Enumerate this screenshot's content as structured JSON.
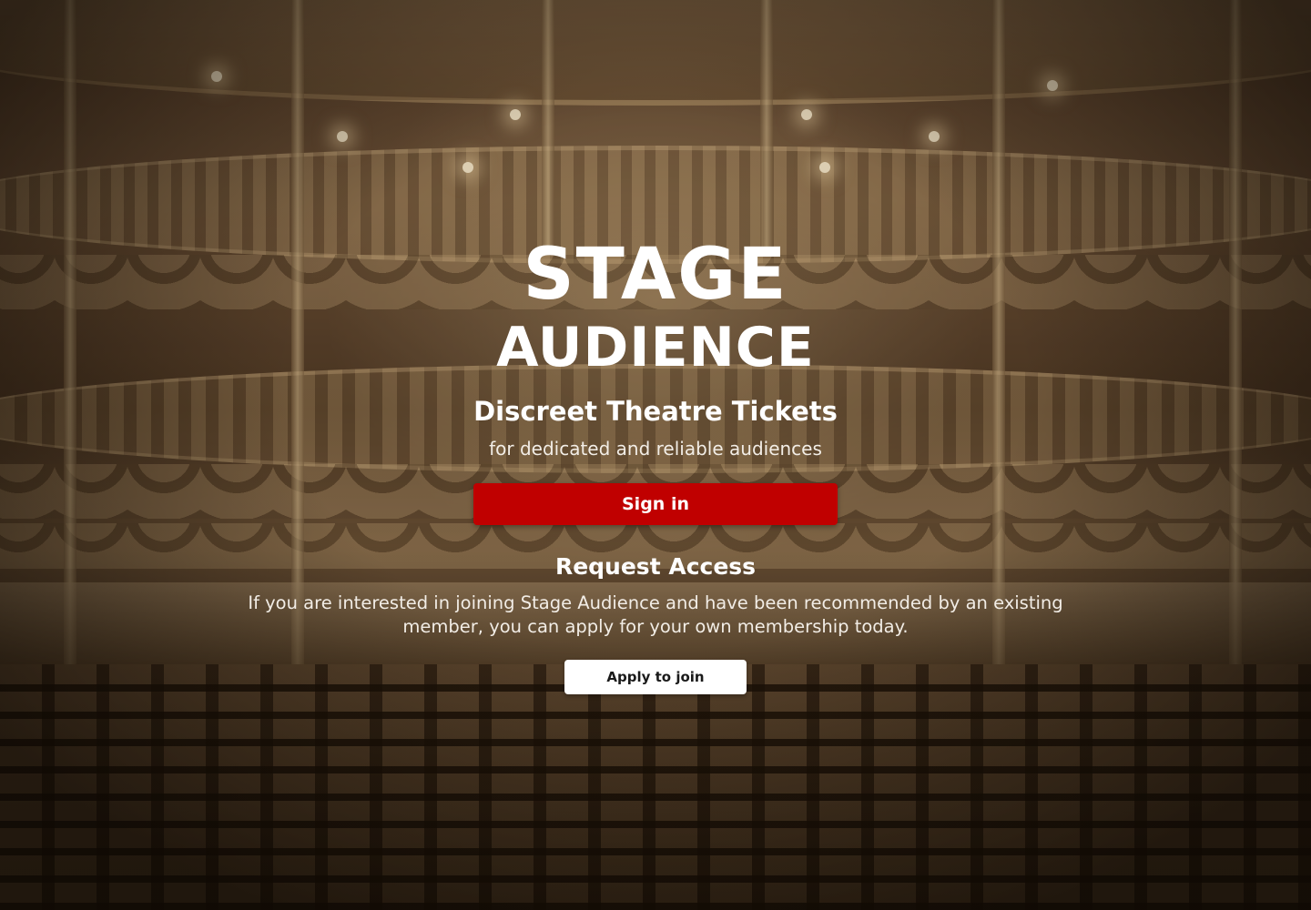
{
  "brand": {
    "line1": "STAGE",
    "line2": "AUDIENCE"
  },
  "hero": {
    "tagline": "Discreet Theatre Tickets",
    "subtagline": "for dedicated and reliable audiences",
    "signin_label": "Sign in"
  },
  "request_access": {
    "title": "Request Access",
    "text": "If you are interested in joining Stage Audience and have been recommended by an existing member, you can apply for your own membership today.",
    "apply_label": "Apply to join"
  },
  "colors": {
    "primary_button": "#c00000",
    "secondary_button": "#ffffff",
    "text": "#ffffff",
    "background_tone": "#4a3624"
  }
}
